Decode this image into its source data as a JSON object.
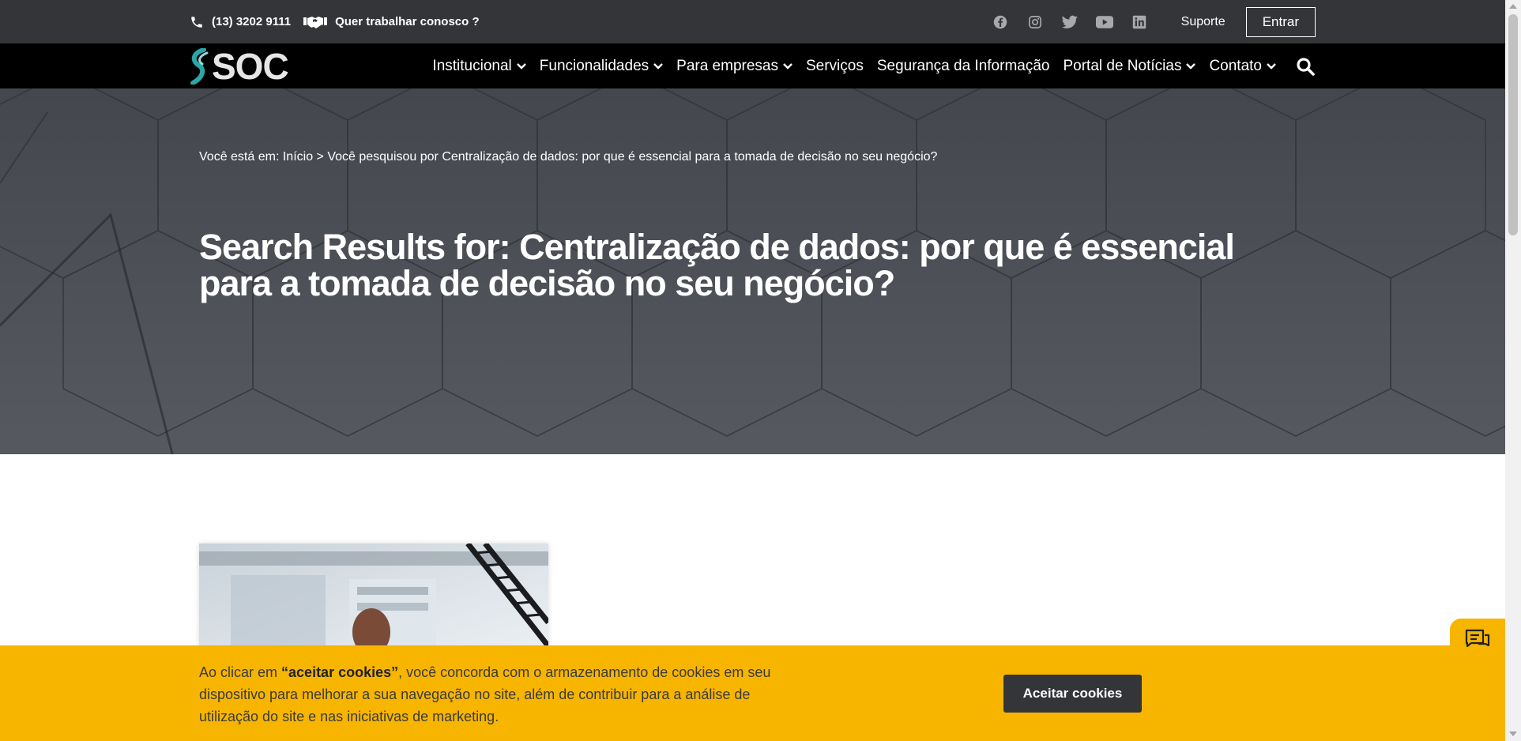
{
  "topbar": {
    "phone": "(13) 3202 9111",
    "careers": "Quer trabalhar conosco ?",
    "social": [
      "facebook-icon",
      "instagram-icon",
      "twitter-icon",
      "youtube-icon",
      "linkedin-icon"
    ],
    "support": "Suporte",
    "login": "Entrar"
  },
  "nav": {
    "logo": "SOC",
    "items": [
      {
        "label": "Institucional",
        "dropdown": true
      },
      {
        "label": "Funcionalidades",
        "dropdown": true
      },
      {
        "label": "Para empresas",
        "dropdown": true
      },
      {
        "label": "Serviços",
        "dropdown": false
      },
      {
        "label": "Segurança da Informação",
        "dropdown": false
      },
      {
        "label": "Portal de Notícias",
        "dropdown": true
      },
      {
        "label": "Contato",
        "dropdown": true
      }
    ]
  },
  "hero": {
    "breadcrumb_prefix": "Você está em: ",
    "breadcrumb_home": "Início",
    "breadcrumb_sep": " > ",
    "breadcrumb_current": "Você pesquisou por Centralização de dados: por que é essencial para a tomada de decisão no seu negócio?",
    "title": "Search Results for: Centralização de dados: por que é essencial para a tomada de decisão no seu negócio?"
  },
  "cookie": {
    "text_before": "Ao clicar em ",
    "text_bold": "“aceitar cookies”",
    "text_after": ", você concorda com o armazenamento de cookies em seu dispositivo para melhorar a sua navegação no site, além de contribuir para a análise de utilização do site e nas iniciativas de marketing.",
    "button": "Aceitar cookies"
  },
  "colors": {
    "topbar": "#333538",
    "navbar": "#000000",
    "hero": "#4b4e55",
    "accent": "#f7b500",
    "logo_teal": "#2aa7a8"
  }
}
